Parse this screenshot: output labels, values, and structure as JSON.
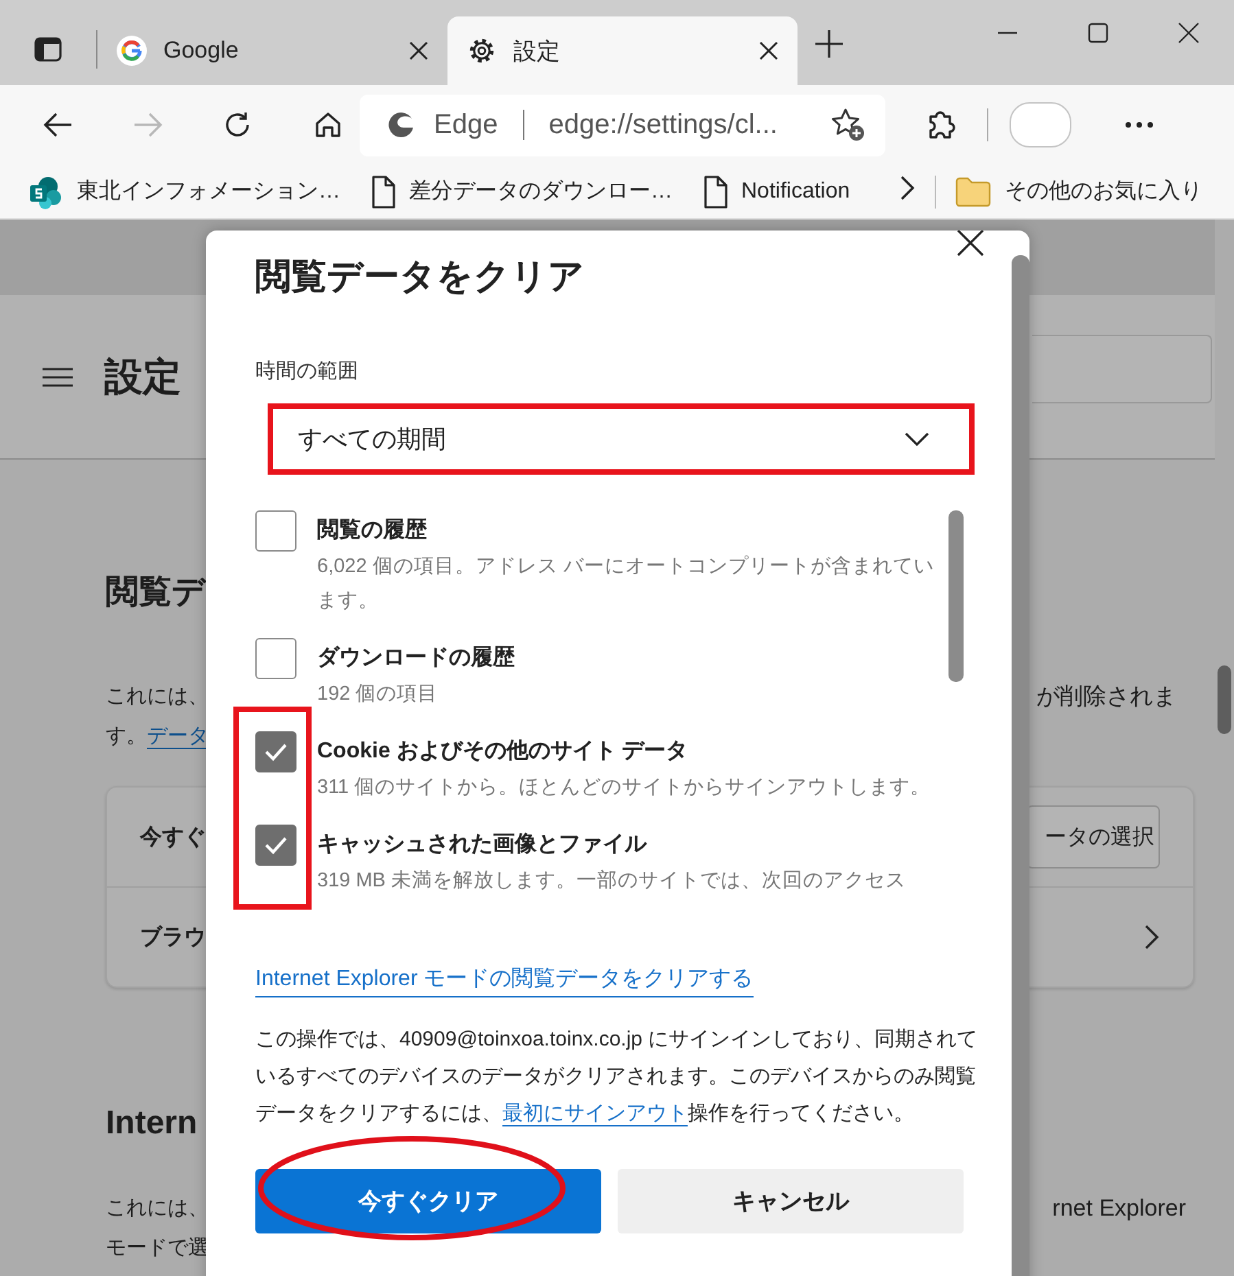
{
  "tabs": [
    {
      "title": "Google",
      "selected": false
    },
    {
      "title": "設定",
      "selected": true
    }
  ],
  "nav_buttons": [
    {
      "kind": "back",
      "disabled": false
    },
    {
      "kind": "forward",
      "disabled": true
    },
    {
      "kind": "refresh",
      "disabled": false
    },
    {
      "kind": "home",
      "disabled": false
    }
  ],
  "address_bar": {
    "site_label": "Edge",
    "url": "edge://settings/cl..."
  },
  "bookmarks": [
    {
      "kind": "site",
      "title": "東北インフォメーション…"
    },
    {
      "kind": "page",
      "title": "差分データのダウンロー…"
    },
    {
      "kind": "page",
      "title": "Notification"
    }
  ],
  "other_favorites": "その他のお気に入り",
  "settings_page": {
    "title": "設定",
    "section_title": "閲覧デ",
    "intro_left": "これには、",
    "intro_right": "が削除されま",
    "intro_line2": "す。",
    "intro_link": "データ",
    "card_rows": [
      {
        "kind": "button",
        "left": "今すぐ",
        "button": "ータの選択"
      },
      {
        "kind": "chevron",
        "left": "ブラウ"
      }
    ],
    "ie_section_title": "Intern",
    "ie_left": "これには、",
    "ie_right": "rnet Explorer",
    "ie_line2": "モードで選"
  },
  "dialog": {
    "title": "閲覧データをクリア",
    "time_range": {
      "label": "時間の範囲",
      "value": "すべての期間",
      "highlighted": true
    },
    "items": [
      {
        "title": "閲覧の履歴",
        "description": "6,022 個の項目。アドレス バーにオートコンプリートが含まれています。",
        "checked": false,
        "highlighted": false
      },
      {
        "title": "ダウンロードの履歴",
        "description": "192 個の項目",
        "checked": false,
        "highlighted": false
      },
      {
        "title": "Cookie およびその他のサイト データ",
        "description": "311 個のサイトから。ほとんどのサイトからサインアウトします。",
        "checked": true,
        "highlighted": true
      },
      {
        "title": "キャッシュされた画像とファイル",
        "description": "319 MB 未満を解放します。一部のサイトでは、次回のアクセス",
        "checked": true,
        "highlighted": true
      }
    ],
    "ie_link": "Internet Explorer モードの閲覧データをクリアする",
    "info": "この操作では、40909@toinxoa.toinx.co.jp にサインインしており、同期されているすべてのデバイスのデータがクリアされます。このデバイスからのみ閲覧データをクリアするには、",
    "sign_out_link": "最初にサインアウト",
    "info_end": "操作を行ってください。",
    "buttons": [
      {
        "kind": "primary",
        "label": "今すぐクリア",
        "circled": true
      },
      {
        "kind": "secondary",
        "label": "キャンセル",
        "circled": false
      }
    ]
  }
}
